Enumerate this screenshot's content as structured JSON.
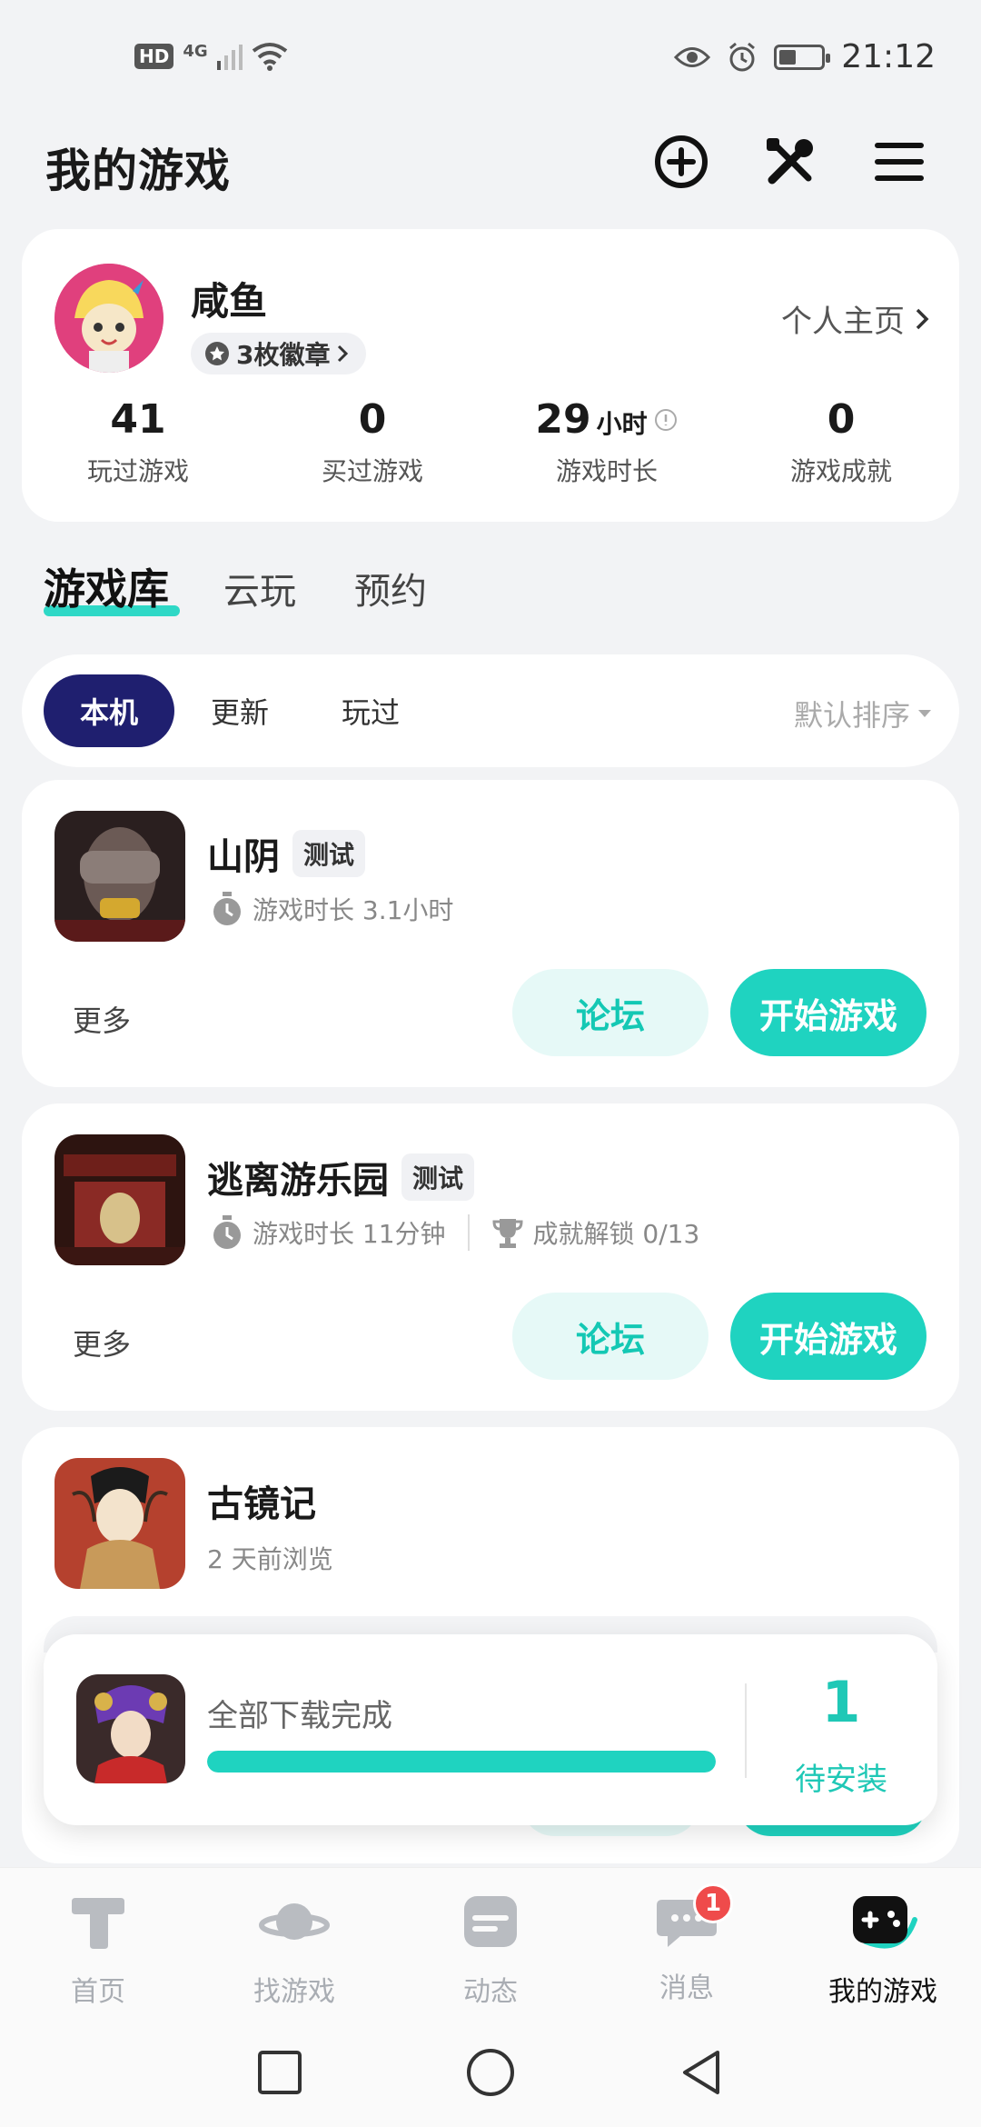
{
  "status_bar": {
    "left": {
      "hd": "HD",
      "network": "4G"
    },
    "time": "21:12"
  },
  "header": {
    "title": "我的游戏",
    "icons": [
      "add-circle-icon",
      "tools-icon",
      "menu-icon"
    ]
  },
  "profile": {
    "name": "咸鱼",
    "badges": "3枚徽章",
    "homepage_link": "个人主页",
    "stats": [
      {
        "value": "41",
        "unit": "",
        "label": "玩过游戏"
      },
      {
        "value": "0",
        "unit": "",
        "label": "买过游戏"
      },
      {
        "value": "29",
        "unit": "小时",
        "label": "游戏时长"
      },
      {
        "value": "0",
        "unit": "",
        "label": "游戏成就"
      }
    ]
  },
  "tabs": [
    {
      "label": "游戏库",
      "active": true
    },
    {
      "label": "云玩",
      "active": false
    },
    {
      "label": "预约",
      "active": false
    }
  ],
  "filters": {
    "chips": [
      {
        "label": "本机",
        "active": true
      },
      {
        "label": "更新",
        "active": false
      },
      {
        "label": "玩过",
        "active": false
      }
    ],
    "sort": "默认排序"
  },
  "games": [
    {
      "name": "山阴",
      "tag": "测试",
      "playtime": "游戏时长 3.1小时",
      "achievements": "",
      "more": "更多",
      "forum": "论坛",
      "start": "开始游戏"
    },
    {
      "name": "逃离游乐园",
      "tag": "测试",
      "playtime": "游戏时长 11分钟",
      "achievements": "成就解锁 0/13",
      "more": "更多",
      "forum": "论坛",
      "start": "开始游戏"
    },
    {
      "name": "古镜记",
      "tag": "",
      "browsed": "2 天前浏览"
    }
  ],
  "download": {
    "status": "全部下载完成",
    "progress": 1.0,
    "pending_count": "1",
    "pending_label": "待安装"
  },
  "bottom_nav": [
    {
      "label": "首页",
      "icon": "home-icon",
      "active": false
    },
    {
      "label": "找游戏",
      "icon": "planet-icon",
      "active": false
    },
    {
      "label": "动态",
      "icon": "feed-icon",
      "active": false
    },
    {
      "label": "消息",
      "icon": "message-icon",
      "active": false,
      "badge": "1"
    },
    {
      "label": "我的游戏",
      "icon": "gamepad-icon",
      "active": true
    }
  ],
  "colors": {
    "accent": "#1fd3c0",
    "chip_active": "#1f1f6f",
    "badge_red": "#ef4b4b"
  }
}
